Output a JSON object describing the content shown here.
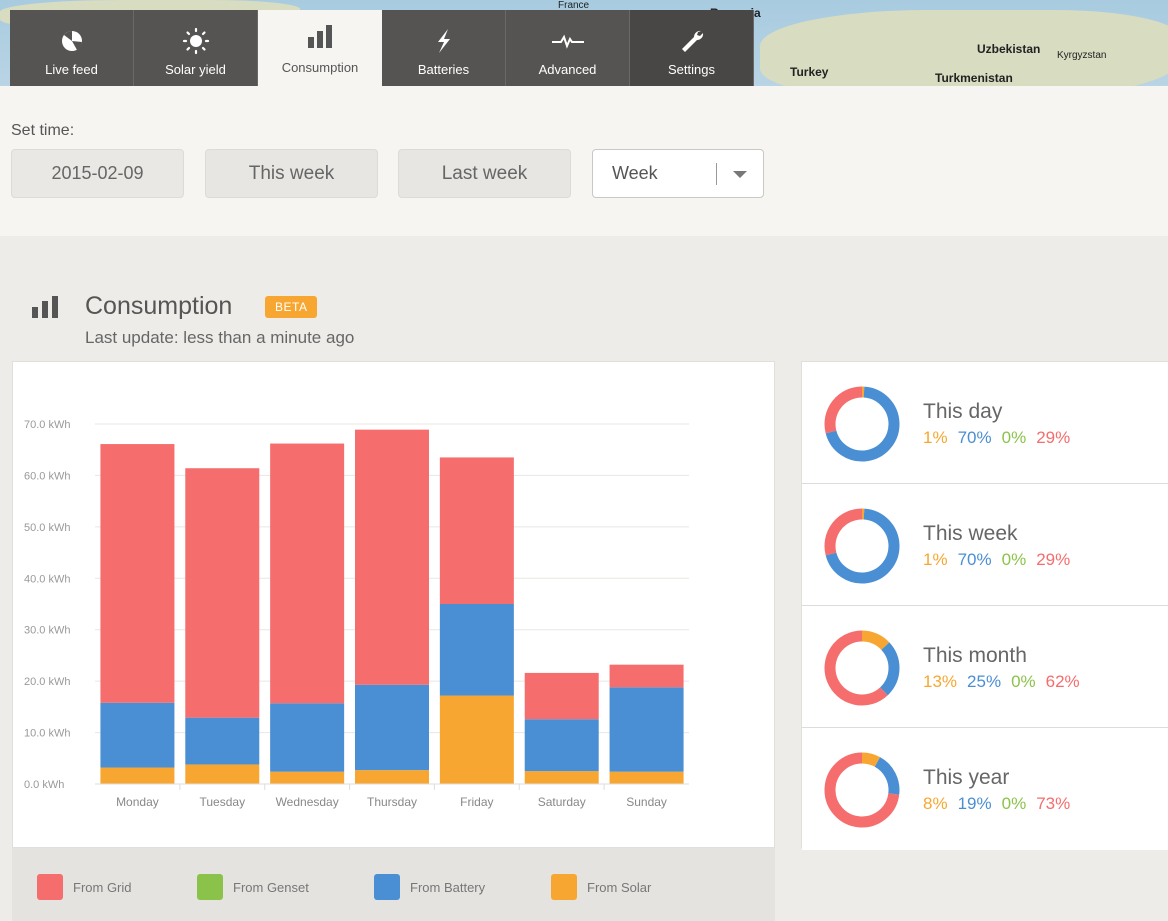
{
  "map": {
    "labels": [
      "Uzbekistan",
      "Kyrgyzstan",
      "Turkey",
      "Turkmenistan",
      "Romania",
      "France"
    ]
  },
  "nav": {
    "tabs": [
      {
        "label": "Live feed",
        "icon": "pie-icon"
      },
      {
        "label": "Solar yield",
        "icon": "sun-icon"
      },
      {
        "label": "Consumption",
        "icon": "bars-icon",
        "active": true
      },
      {
        "label": "Batteries",
        "icon": "lightning-icon"
      },
      {
        "label": "Advanced",
        "icon": "pulse-icon"
      },
      {
        "label": "Settings",
        "icon": "wrench-icon"
      }
    ]
  },
  "set_time": {
    "label": "Set time:",
    "date": "2015-02-09",
    "this_week": "This week",
    "last_week": "Last week",
    "period": "Week"
  },
  "section": {
    "title": "Consumption",
    "badge": "BETA",
    "subtitle": "Last update: less than a minute ago"
  },
  "colors": {
    "grid": "#f56d6d",
    "genset": "#8bc34a",
    "battery": "#4a8fd3",
    "solar": "#f7a731"
  },
  "legend": [
    "From Grid",
    "From Genset",
    "From Battery",
    "From Solar"
  ],
  "chart_data": {
    "type": "bar",
    "stacked": true,
    "categories": [
      "Monday",
      "Tuesday",
      "Wednesday",
      "Thursday",
      "Friday",
      "Saturday",
      "Sunday"
    ],
    "y_ticks": [
      "0.0 kWh",
      "10.0 kWh",
      "20.0 kWh",
      "30.0 kWh",
      "40.0 kWh",
      "50.0 kWh",
      "60.0 kWh",
      "70.0 kWh"
    ],
    "ylim": [
      0,
      70
    ],
    "series": [
      {
        "name": "From Solar",
        "values": [
          3.2,
          3.8,
          2.4,
          2.7,
          17.2,
          2.5,
          2.4
        ]
      },
      {
        "name": "From Battery",
        "values": [
          12.6,
          9.1,
          13.3,
          16.6,
          17.8,
          10.1,
          16.4
        ]
      },
      {
        "name": "From Genset",
        "values": [
          0,
          0,
          0,
          0,
          0,
          0,
          0
        ]
      },
      {
        "name": "From Grid",
        "values": [
          50.3,
          48.5,
          50.5,
          49.6,
          28.5,
          9.0,
          4.4
        ]
      }
    ],
    "legend_position": "bottom",
    "grid": true
  },
  "stats": [
    {
      "name": "This day",
      "solar": "1%",
      "battery": "70%",
      "genset": "0%",
      "grid": "29%"
    },
    {
      "name": "This week",
      "solar": "1%",
      "battery": "70%",
      "genset": "0%",
      "grid": "29%"
    },
    {
      "name": "This month",
      "solar": "13%",
      "battery": "25%",
      "genset": "0%",
      "grid": "62%"
    },
    {
      "name": "This year",
      "solar": "8%",
      "battery": "19%",
      "genset": "0%",
      "grid": "73%"
    }
  ]
}
